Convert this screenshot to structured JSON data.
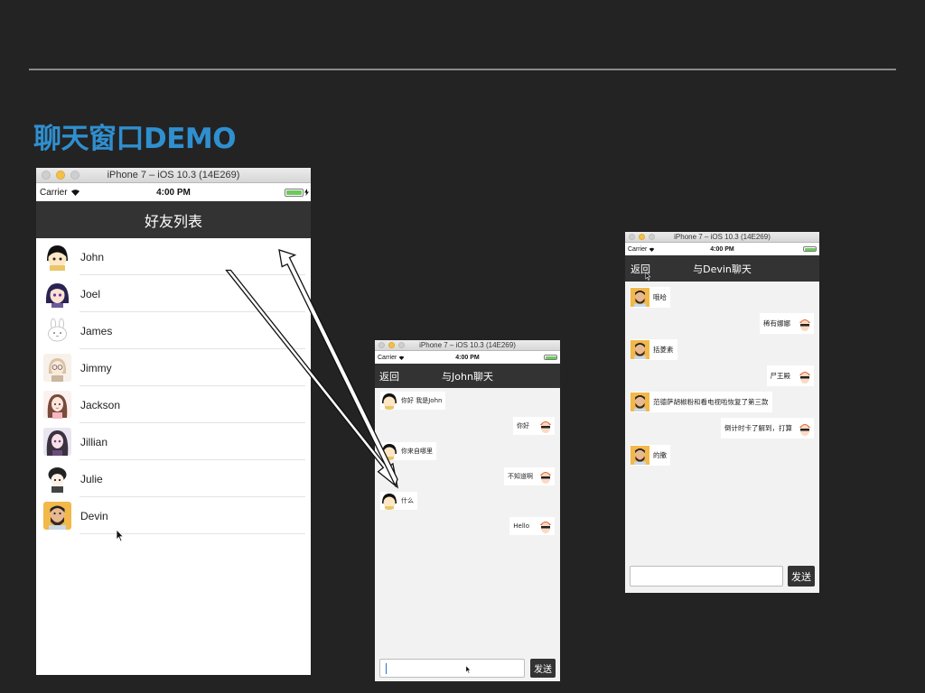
{
  "slide": {
    "title": "聊天窗口DEMO"
  },
  "sim1": {
    "window_title": "iPhone 7 – iOS 10.3 (14E269)",
    "carrier": "Carrier",
    "time": "4:00 PM",
    "nav_title": "好友列表",
    "friends": [
      {
        "name": "John"
      },
      {
        "name": "Joel"
      },
      {
        "name": "James"
      },
      {
        "name": "Jimmy"
      },
      {
        "name": "Jackson"
      },
      {
        "name": "Jillian"
      },
      {
        "name": "Julie"
      },
      {
        "name": "Devin"
      }
    ]
  },
  "sim2": {
    "window_title": "iPhone 7 – iOS 10.3 (14E269)",
    "carrier": "Carrier",
    "time": "4:00 PM",
    "back_label": "返回",
    "nav_title": "与John聊天",
    "messages": [
      {
        "text": "你好 我是John",
        "side": "left"
      },
      {
        "text": "你好",
        "side": "right"
      },
      {
        "text": "你来自哪里",
        "side": "left"
      },
      {
        "text": "不知道啊",
        "side": "right"
      },
      {
        "text": "什么",
        "side": "left"
      },
      {
        "text": "Hello",
        "side": "right"
      }
    ],
    "input_value": "",
    "send_label": "发送"
  },
  "sim3": {
    "window_title": "iPhone 7 – iOS 10.3 (14E269)",
    "carrier": "Carrier",
    "time": "4:00 PM",
    "back_label": "返回",
    "nav_title": "与Devin聊天",
    "messages": [
      {
        "text": "哦哈",
        "side": "left"
      },
      {
        "text": "稀有娜娜",
        "side": "right"
      },
      {
        "text": "括菱素",
        "side": "left"
      },
      {
        "text": "尸王殿",
        "side": "right"
      },
      {
        "text": "范德萨胡椒粉和看电视啦恢复了第三款",
        "side": "left"
      },
      {
        "text": "倒计时卡了解到，打算",
        "side": "right"
      },
      {
        "text": "的撒",
        "side": "left"
      }
    ],
    "input_value": "",
    "send_label": "发送"
  },
  "colors": {
    "title_blue": "#2f8fcf",
    "navbar": "#333333",
    "chat_bg": "#f2f2f2",
    "battery": "#6dc95c"
  }
}
